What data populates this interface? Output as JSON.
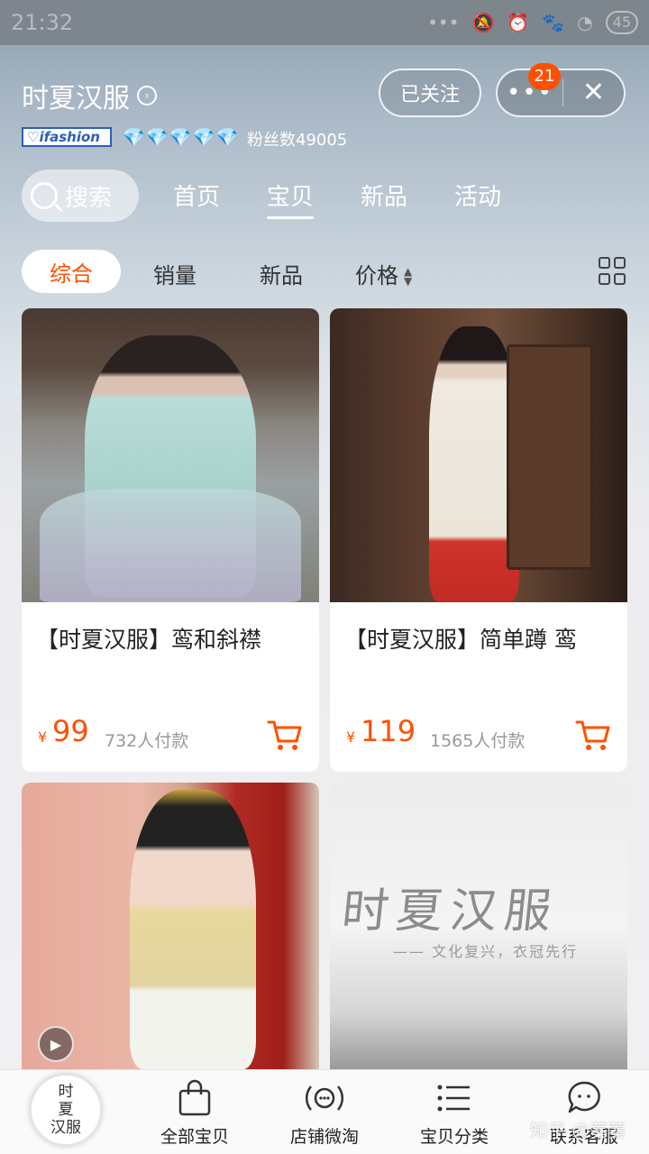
{
  "status_bar": {
    "time": "21:32",
    "battery": "45"
  },
  "shop": {
    "name": "时夏汉服",
    "follow_label": "已关注",
    "more_badge": "21",
    "brand_tag": "ifashion",
    "fans": "粉丝数49005"
  },
  "nav": {
    "search": "搜索",
    "tabs": [
      "首页",
      "宝贝",
      "新品",
      "活动"
    ],
    "active_tab": "宝贝"
  },
  "sort": {
    "items": [
      "综合",
      "销量",
      "新品",
      "价格"
    ],
    "active": "综合"
  },
  "products": [
    {
      "title": "【时夏汉服】鸾和斜襟",
      "currency": "¥",
      "price": "99",
      "sold": "732人付款"
    },
    {
      "title": "【时夏汉服】简单蹲 鸾",
      "currency": "¥",
      "price": "119",
      "sold": "1565人付款"
    },
    {
      "title": "",
      "has_video": true
    },
    {
      "calligraphy": "时夏汉服",
      "slogan": "—— 文化复兴，衣冠先行"
    }
  ],
  "bottom_bar": {
    "shop_logo_text": "时\n夏\n汉\n服",
    "tabs": [
      "全部宝贝",
      "店铺微淘",
      "宝贝分类",
      "联系客服"
    ]
  },
  "watermark": "知乎 @蓁蓁",
  "colors": {
    "accent": "#ff5000",
    "price": "#ff5000"
  }
}
